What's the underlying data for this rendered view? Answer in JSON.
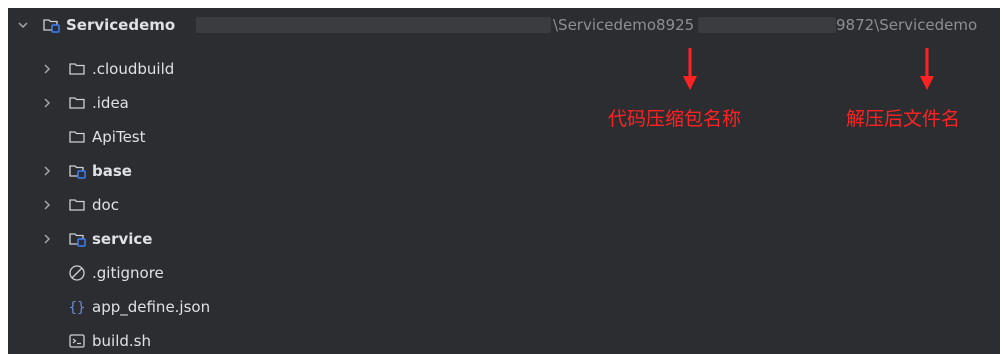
{
  "tree": {
    "root": {
      "name": "Servicedemo",
      "path_part1": "\\Servicedemo8925",
      "path_part2": "9872\\Servicedemo"
    },
    "items": [
      {
        "label": ".cloudbuild",
        "icon": "folder-icon",
        "expandable": true,
        "bold": false
      },
      {
        "label": ".idea",
        "icon": "folder-icon",
        "expandable": true,
        "bold": false
      },
      {
        "label": "ApiTest",
        "icon": "folder-icon",
        "expandable": false,
        "bold": false
      },
      {
        "label": "base",
        "icon": "module-folder-icon",
        "expandable": true,
        "bold": true
      },
      {
        "label": "doc",
        "icon": "folder-icon",
        "expandable": true,
        "bold": false
      },
      {
        "label": "service",
        "icon": "module-folder-icon",
        "expandable": true,
        "bold": true
      },
      {
        "label": ".gitignore",
        "icon": "ignored-file-icon",
        "expandable": false,
        "bold": false
      },
      {
        "label": "app_define.json",
        "icon": "json-file-icon",
        "expandable": false,
        "bold": false
      },
      {
        "label": "build.sh",
        "icon": "shell-script-icon",
        "expandable": false,
        "bold": false
      }
    ]
  },
  "annotations": {
    "left": "代码压缩包名称",
    "right": "解压后文件名",
    "color": "#ff2222"
  },
  "colors": {
    "background": "#2b2d30",
    "text": "#dfe1e5",
    "muted_text": "#8c8f94",
    "module_badge": "#3d7ef6",
    "json_icon": "#6b8cd9"
  }
}
